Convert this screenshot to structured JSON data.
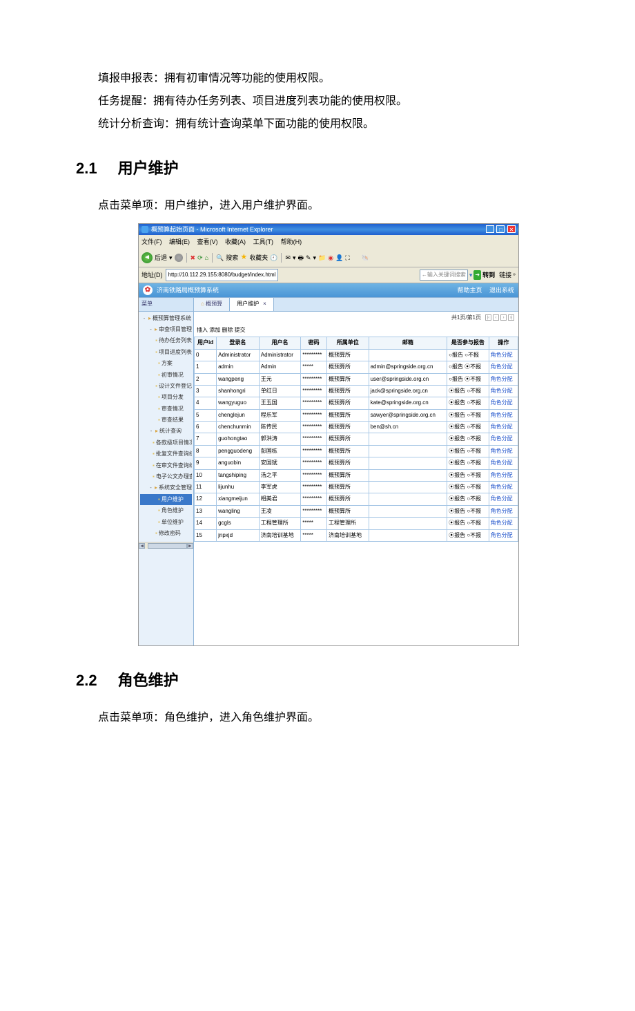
{
  "paragraphs": {
    "p1": "填报申报表：拥有初审情况等功能的使用权限。",
    "p2": "任务提醒：拥有待办任务列表、项目进度列表功能的使用权限。",
    "p3": "统计分析查询：拥有统计查询菜单下面功能的使用权限。"
  },
  "h2_1": {
    "num": "2.1",
    "title": "用户维护"
  },
  "p_enter_user": "点击菜单项：用户维护，进入用户维护界面。",
  "h2_2": {
    "num": "2.2",
    "title": "角色维护"
  },
  "p_enter_role": "点击菜单项：角色维护，进入角色维护界面。",
  "ie": {
    "title": "概预算起始页面 - Microsoft Internet Explorer",
    "menu": {
      "file": "文件(F)",
      "edit": "编辑(E)",
      "view": "查看(V)",
      "fav": "收藏(A)",
      "tools": "工具(T)",
      "help": "帮助(H)"
    },
    "tb": {
      "back": "后退",
      "search": "搜索",
      "fav": "收藏夹"
    },
    "addr_label": "地址(D)",
    "url": "http://10.112.29.155:8080/budget/index.html",
    "search_placeholder": "←输入关键词搜索",
    "go": "转到",
    "links": "链接"
  },
  "app": {
    "system_title": "济南铁路局概预算系统",
    "act_help": "帮助主页",
    "act_logout": "退出系统",
    "side_header": "菜单",
    "tab_home": "概预算",
    "tab_user": "用户维护",
    "ops": "插入 添加 删除 提交",
    "pager": "共1页/第1页"
  },
  "tree": [
    {
      "pm": "-",
      "icon": "folder",
      "label": "概预算管理系统"
    },
    {
      "pm": "-",
      "icon": "folder",
      "label": "审查项目管理",
      "child": true
    },
    {
      "icon": "doc",
      "label": "待办任务列表",
      "child2": true
    },
    {
      "icon": "doc",
      "label": "项目进度列表",
      "child2": true
    },
    {
      "icon": "doc",
      "label": "方案",
      "child2": true
    },
    {
      "icon": "doc",
      "label": "初审情况",
      "child2": true
    },
    {
      "icon": "doc",
      "label": "设计文件登记",
      "child2": true
    },
    {
      "icon": "doc",
      "label": "项目分发",
      "child2": true
    },
    {
      "icon": "doc",
      "label": "审查情况",
      "child2": true
    },
    {
      "icon": "doc",
      "label": "审查结果",
      "child2": true
    },
    {
      "pm": "-",
      "icon": "folder",
      "label": "统计查询",
      "child": true
    },
    {
      "icon": "doc",
      "label": "各款级项目情况统计",
      "child2": true
    },
    {
      "icon": "doc",
      "label": "批复文件查询统计",
      "child2": true
    },
    {
      "icon": "doc",
      "label": "在审文件查询统计",
      "child2": true
    },
    {
      "icon": "doc",
      "label": "电子公文办理查看",
      "child2": true
    },
    {
      "pm": "-",
      "icon": "folder",
      "label": "系统安全管理",
      "child": true
    },
    {
      "icon": "doc",
      "label": "用户维护",
      "child2": true,
      "sel": true
    },
    {
      "icon": "doc",
      "label": "角色维护",
      "child2": true
    },
    {
      "icon": "doc",
      "label": "单位维护",
      "child2": true
    },
    {
      "icon": "doc",
      "label": "修改密码",
      "child": true
    }
  ],
  "grid": {
    "headers": [
      "用户id",
      "登录名",
      "用户名",
      "密码",
      "所属单位",
      "邮箱",
      "是否参与报告",
      "操作"
    ],
    "rows": [
      [
        "0",
        "Administrator",
        "Administrator",
        "*********",
        "概预算所",
        "",
        "○报告 ○不报",
        "角色分配"
      ],
      [
        "1",
        "admin",
        "Admin",
        "*****",
        "概预算所",
        "admin@springside.org.cn",
        "○报告 ⦿不报",
        "角色分配"
      ],
      [
        "2",
        "wangpeng",
        "王元",
        "*********",
        "概预算所",
        "user@springside.org.cn",
        "○报告 ⦿不报",
        "角色分配"
      ],
      [
        "3",
        "shanhongri",
        "单红日",
        "*********",
        "概预算所",
        "jack@springside.org.cn",
        "⦿报告 ○不报",
        "角色分配"
      ],
      [
        "4",
        "wangyuguo",
        "王玉国",
        "*********",
        "概预算所",
        "kate@springside.org.cn",
        "⦿报告 ○不报",
        "角色分配"
      ],
      [
        "5",
        "chenglejun",
        "程乐军",
        "*********",
        "概预算所",
        "sawyer@springside.org.cn",
        "⦿报告 ○不报",
        "角色分配"
      ],
      [
        "6",
        "chenchunmin",
        "陈传民",
        "*********",
        "概预算所",
        "ben@sh.cn",
        "⦿报告 ○不报",
        "角色分配"
      ],
      [
        "7",
        "guohongtao",
        "郭洪涛",
        "*********",
        "概预算所",
        "",
        "⦿报告 ○不报",
        "角色分配"
      ],
      [
        "8",
        "pengguodeng",
        "彭国栋",
        "*********",
        "概预算所",
        "",
        "⦿报告 ○不报",
        "角色分配"
      ],
      [
        "9",
        "anguobin",
        "安国斌",
        "*********",
        "概预算所",
        "",
        "⦿报告 ○不报",
        "角色分配"
      ],
      [
        "10",
        "tangshiping",
        "汤之平",
        "*********",
        "概预算所",
        "",
        "⦿报告 ○不报",
        "角色分配"
      ],
      [
        "11",
        "lijunhu",
        "李军虎",
        "*********",
        "概预算所",
        "",
        "⦿报告 ○不报",
        "角色分配"
      ],
      [
        "12",
        "xiangmeijun",
        "相美君",
        "*********",
        "概预算所",
        "",
        "⦿报告 ○不报",
        "角色分配"
      ],
      [
        "13",
        "wangling",
        "王凌",
        "*********",
        "概预算所",
        "",
        "⦿报告 ○不报",
        "角色分配"
      ],
      [
        "14",
        "gcgls",
        "工程管理所",
        "*****",
        "工程管理所",
        "",
        "⦿报告 ○不报",
        "角色分配"
      ],
      [
        "15",
        "jnpxjd",
        "济南培训基地",
        "*****",
        "济南培训基地",
        "",
        "⦿报告 ○不报",
        "角色分配"
      ]
    ]
  }
}
